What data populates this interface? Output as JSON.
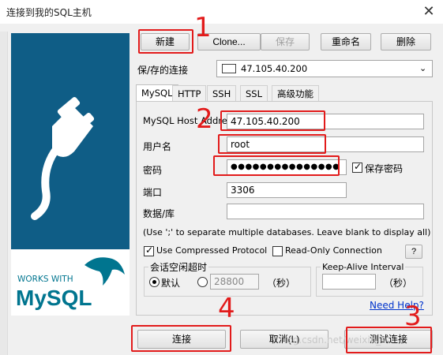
{
  "window": {
    "title": "连接到我的SQL主机",
    "close_glyph": "✕"
  },
  "toolbar": {
    "new": "新建",
    "clone": "Clone...",
    "save": "保存",
    "rename": "重命名",
    "delete": "删除"
  },
  "saved_connection": {
    "label": "保/存的连接",
    "value": "47.105.40.200"
  },
  "tabs": [
    "MySQL",
    "HTTP",
    "SSH",
    "SSL",
    "高级功能"
  ],
  "mysql": {
    "host_label": "MySQL Host Address",
    "host_value": "47.105.40.200",
    "user_label": "用户名",
    "user_value": "root",
    "password_label": "密码",
    "password_value": "●●●●●●●●●●●●●●●",
    "save_password_label": "保存密码",
    "save_password_checked": true,
    "port_label": "端口",
    "port_value": "3306",
    "database_label": "数据/库",
    "database_value": "",
    "hint": "(Use ';' to separate multiple databases. Leave blank to display all)",
    "compressed_label": "Use Compressed Protocol",
    "compressed_checked": true,
    "readonly_label": "Read-Only Connection",
    "readonly_checked": false,
    "help_btn": "?",
    "idle_group_title": "会话空闲超时",
    "idle_default_label": "默认",
    "idle_value": "28800",
    "idle_unit": "（秒）",
    "keepalive_title": "Keep-Alive Interval",
    "keepalive_value": "",
    "keepalive_unit": "（秒）",
    "need_help": "Need Help?"
  },
  "footer": {
    "connect": "连接",
    "cancel": "取消(L)",
    "test": "测试连接"
  },
  "banner": {
    "works_with": "WORKS WITH",
    "mysql_word": "MySQL"
  },
  "annotations": {
    "n1": "1",
    "n2": "2",
    "n3": "3",
    "n4": "4"
  },
  "watermark": "log.csdn.net/weixin_4",
  "colors": {
    "banner_bg": "#0f5d86",
    "annotation_red": "#e21b1b",
    "mysql_blue": "#00758f",
    "mysql_orange": "#f29111"
  }
}
